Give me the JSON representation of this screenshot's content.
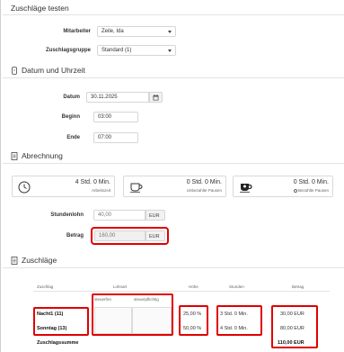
{
  "title": "Zuschläge testen",
  "form": {
    "mitarbeiter_label": "Mitarbeiter",
    "mitarbeiter_value": "Zeile, Ida",
    "gruppe_label": "Zuschlagsgruppe",
    "gruppe_value": "Standard (1)"
  },
  "datum_section": {
    "title": "Datum und Uhrzeit",
    "datum_label": "Datum",
    "datum_value": "30.11.2025",
    "beginn_label": "Beginn",
    "beginn_value": "03:00",
    "ende_label": "Ende",
    "ende_value": "07:00"
  },
  "abrechnung": {
    "title": "Abrechnung",
    "cards": [
      {
        "value": "4 Std. 0 Min.",
        "caption": "Arbeitszeit",
        "icon": "clock-icon"
      },
      {
        "value": "0 Std. 0 Min.",
        "caption": "Unbezahlte Pausen",
        "icon": "coffee-cup-icon"
      },
      {
        "value": "0 Std. 0 Min.",
        "caption": "Bezahlte Pausen",
        "icon": "coffee-cup-filled-icon"
      }
    ],
    "stundenlohn_label": "Stundenlohn",
    "stundenlohn_value": "40,00",
    "stundenlohn_unit": "EUR",
    "betrag_label": "Betrag",
    "betrag_value": "160,00",
    "betrag_unit": "EUR"
  },
  "zuschlaege": {
    "title": "Zuschläge",
    "headers": {
      "zuschlag": "Zuschlag",
      "lohnart": "Lohnart",
      "hoehe": "Höhe",
      "stunden": "Stunden",
      "betrag": "Betrag",
      "steuerfrei": "steuerfrei",
      "steuerpflichtig": "steuerpflichtig"
    },
    "rows": [
      {
        "name": "Nacht1 (11)",
        "hoehe": "25,00 %",
        "stunden": "3 Std. 0 Min.",
        "betrag": "30,00 EUR"
      },
      {
        "name": "Sonntag (13)",
        "hoehe": "50,00 %",
        "stunden": "4 Std. 0 Min.",
        "betrag": "80,00 EUR"
      }
    ],
    "summe_label": "Zuschlagssumme",
    "summe_value": "110,00 EUR"
  },
  "colors": {
    "highlight": "#e00000",
    "border": "#d6d6d6"
  }
}
